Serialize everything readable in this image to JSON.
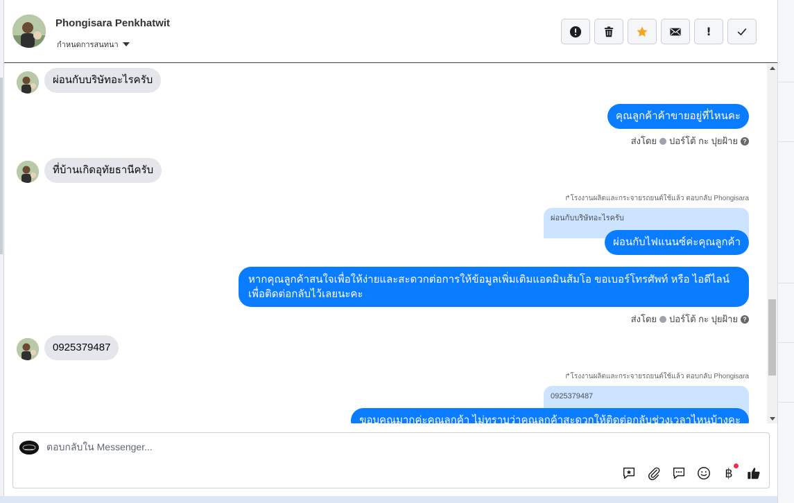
{
  "header": {
    "contact_name": "Phongisara Penkhatwit",
    "assign_label": "กำหนดการสนทนา",
    "actions": [
      {
        "name": "mark-spam-button",
        "icon": "alert-circle-icon"
      },
      {
        "name": "delete-button",
        "icon": "trash-icon"
      },
      {
        "name": "star-button",
        "icon": "star-icon"
      },
      {
        "name": "mark-unread-button",
        "icon": "envelope-icon"
      },
      {
        "name": "follow-up-button",
        "icon": "exclamation-icon"
      },
      {
        "name": "mark-done-button",
        "icon": "check-icon"
      }
    ],
    "bang_text": "!"
  },
  "messages": {
    "m1": "ผ่อนกับบริษัทอะไรครับ",
    "m2": "คุณลูกค้าค้าขายอยู่ที่ไหนคะ",
    "sent_by_1": "ส่งโดย",
    "agent_1": "ปอร์โต้ กะ ปุยฝ้าย",
    "m3": "ที่บ้านเกิดอุทัยธานีครับ",
    "reply_note_1": "โรงงานผลิตและกระจายรถยนต์ใช้แล้ว ตอบกลับ Phongisara",
    "quoted_1": "ผ่อนกับบริษัทอะไรครับ",
    "m4": "ผ่อนกับไฟแนนซ์ค่ะคุณลูกค้า",
    "m5": "หากคุณลูกค้าสนใจเพื่อให้ง่ายและสะดวกต่อการให้ข้อมูลเพิ่มเติมแอดมินส้มโอ ขอเบอร์โทรศัพท์ หรือ ไอดีไลน์ เพื่อติดต่อกลับไว้เลยนะคะ",
    "sent_by_2": "ส่งโดย",
    "agent_2": "ปอร์โต้ กะ ปุยฝ้าย",
    "m6": "0925379487",
    "reply_note_2": "โรงงานผลิตและกระจายรถยนต์ใช้แล้ว ตอบกลับ Phongisara",
    "quoted_2": "0925379487",
    "m7": "ขอบคุณมากค่ะคุณลูกค้า ไม่ทราบว่าคุณลูกค้าสะดวกให้ติดต่อกลับช่วงเวลาไหนบ้างคะ"
  },
  "composer": {
    "placeholder": "ตอบกลับใน Messenger...",
    "tools": [
      "saved-reply-icon",
      "attachment-icon",
      "message-icon",
      "emoji-icon",
      "payment-icon",
      "like-icon"
    ],
    "baht_symbol": "฿"
  },
  "colors": {
    "outgoing_bubble": "#0a7cff",
    "incoming_bubble": "#e4e6eb",
    "quoted_bubble": "#cce4ff",
    "star": "#f5a623",
    "notification_dot": "#f02849"
  }
}
